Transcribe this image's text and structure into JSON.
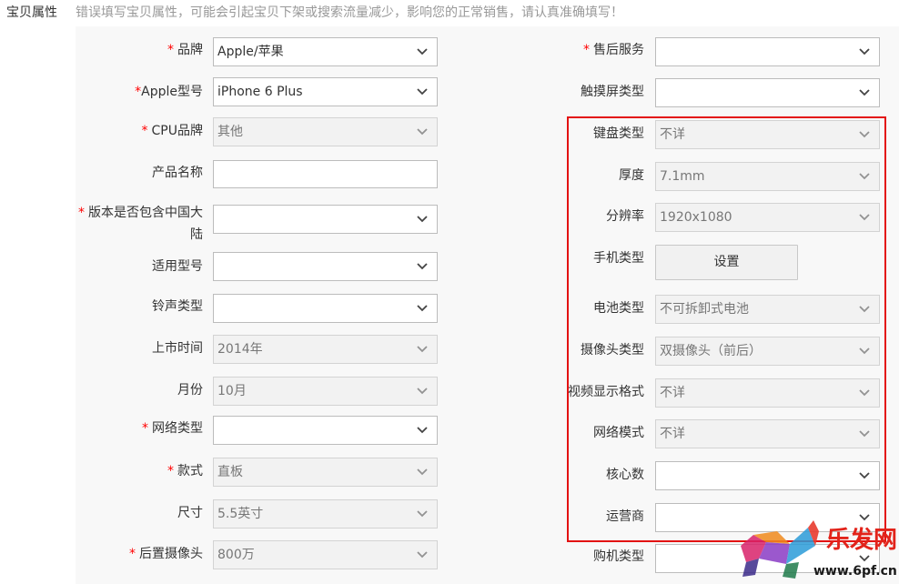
{
  "header": {
    "section_label": "宝贝属性",
    "notice": "错误填写宝贝属性，可能会引起宝贝下架或搜索流量减少，影响您的正常销售，请认真准确填写！"
  },
  "icons": {
    "select_arrow": "chevron-down-icon",
    "watermark": "lefa-fox-logo"
  },
  "colors": {
    "required": "#ff0000",
    "highlight": "#e31212",
    "notice": "#999999"
  },
  "left_fields": [
    {
      "label": "品牌",
      "required": true,
      "value": "Apple/苹果",
      "disabled": false
    },
    {
      "label": "Apple型号",
      "required": true,
      "value": "iPhone 6 Plus",
      "disabled": false
    },
    {
      "label": "CPU品牌",
      "required": true,
      "value": "其他",
      "disabled": true
    },
    {
      "label": "产品名称",
      "required": false,
      "value": "",
      "disabled": false
    },
    {
      "label": "版本是否包含中国大陆",
      "required": true,
      "value": "",
      "disabled": false
    },
    {
      "label": "适用型号",
      "required": false,
      "value": "",
      "disabled": false
    },
    {
      "label": "铃声类型",
      "required": false,
      "value": "",
      "disabled": false
    },
    {
      "label": "上市时间",
      "required": false,
      "value": "2014年",
      "disabled": true
    },
    {
      "label": "月份",
      "required": false,
      "value": "10月",
      "disabled": true
    },
    {
      "label": "网络类型",
      "required": true,
      "value": "",
      "disabled": false
    },
    {
      "label": "款式",
      "required": true,
      "value": "直板",
      "disabled": true
    },
    {
      "label": "尺寸",
      "required": false,
      "value": "5.5英寸",
      "disabled": true
    },
    {
      "label": "后置摄像头",
      "required": true,
      "value": "800万",
      "disabled": true
    }
  ],
  "right_fields": [
    {
      "label": "售后服务",
      "required": true,
      "value": "",
      "disabled": false
    },
    {
      "label": "触摸屏类型",
      "required": false,
      "value": "",
      "disabled": false
    },
    {
      "label": "键盘类型",
      "required": false,
      "value": "不详",
      "disabled": true
    },
    {
      "label": "厚度",
      "required": false,
      "value": "7.1mm",
      "disabled": true
    },
    {
      "label": "分辨率",
      "required": false,
      "value": "1920x1080",
      "disabled": true
    },
    {
      "label": "手机类型",
      "required": false,
      "button_label": "设置"
    },
    {
      "label": "电池类型",
      "required": false,
      "value": "不可拆卸式电池",
      "disabled": true
    },
    {
      "label": "摄像头类型",
      "required": false,
      "value": "双摄像头（前后）",
      "disabled": true
    },
    {
      "label": "视频显示格式",
      "required": false,
      "value": "不详",
      "disabled": true
    },
    {
      "label": "网络模式",
      "required": false,
      "value": "不详",
      "disabled": true
    },
    {
      "label": "核心数",
      "required": false,
      "value": "",
      "disabled": false
    },
    {
      "label": "运营商",
      "required": false,
      "value": "",
      "disabled": false
    },
    {
      "label": "购机类型",
      "required": false,
      "value": "",
      "disabled": false
    }
  ],
  "watermark": {
    "brand": "乐发网",
    "url": "www.6pf.cn"
  }
}
